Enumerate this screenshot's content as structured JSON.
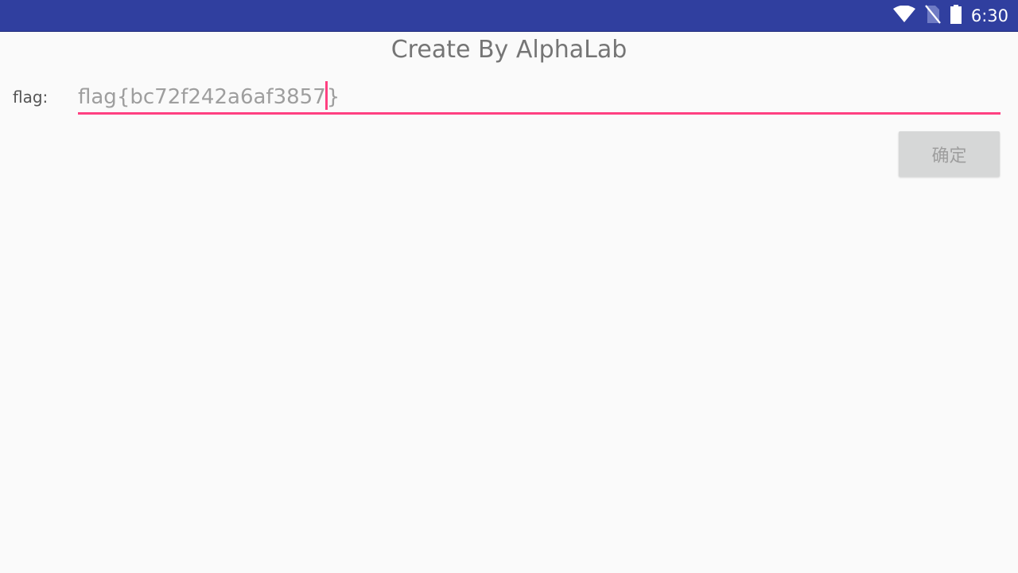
{
  "status_bar": {
    "time": "6:30",
    "icons": [
      "wifi-icon",
      "no-sim-icon",
      "battery-icon"
    ],
    "background_color": "#303f9f"
  },
  "app": {
    "title": "Create By AlphaLab"
  },
  "form": {
    "flag_label": "flag:",
    "input_value_before_cursor": "flag{bc72f242a6af3857",
    "input_value_after_cursor": "}",
    "underline_color": "#ff4081",
    "confirm_label": "确定"
  }
}
